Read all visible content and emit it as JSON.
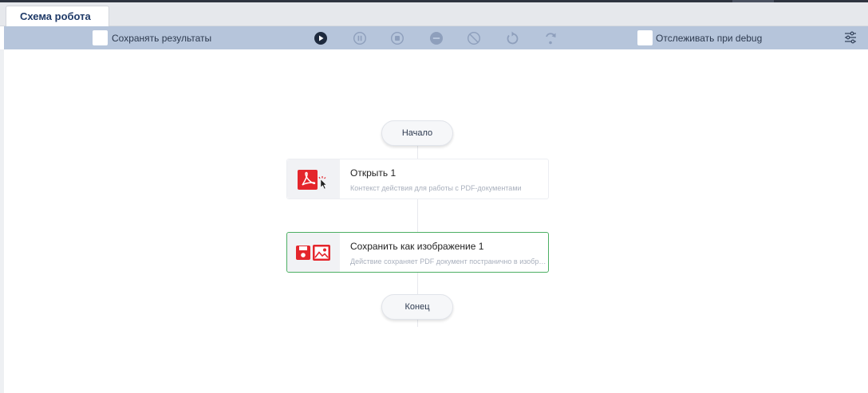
{
  "tab": {
    "title": "Схема робота"
  },
  "toolbar": {
    "save_results_label": "Сохранять результаты",
    "track_debug_label": "Отслеживать при debug",
    "buttons": [
      {
        "icon": "play-icon",
        "enabled": true
      },
      {
        "icon": "pause-icon",
        "enabled": false
      },
      {
        "icon": "stop-icon",
        "enabled": false
      },
      {
        "icon": "minus-circle-icon",
        "enabled": false
      },
      {
        "icon": "cancel-icon",
        "enabled": false
      },
      {
        "icon": "undo-icon",
        "enabled": false
      },
      {
        "icon": "redo-icon",
        "enabled": false
      }
    ],
    "settings_icon": "sliders-icon"
  },
  "flow": {
    "start_label": "Начало",
    "end_label": "Конец",
    "nodes": [
      {
        "title": "Открыть  1",
        "description": "Контекст действия для работы с PDF-документами",
        "icon": "pdf-open-icon",
        "selected": false
      },
      {
        "title": "Сохранить как изображение  1",
        "description": "Действие сохраняет PDF документ постранично в изображения",
        "icon": "save-image-icon",
        "selected": true
      }
    ]
  },
  "colors": {
    "toolbar_bg": "#b6c5db",
    "accent_red": "#e4262c",
    "selected_border": "#4caf63",
    "tab_text": "#1f3a68"
  }
}
